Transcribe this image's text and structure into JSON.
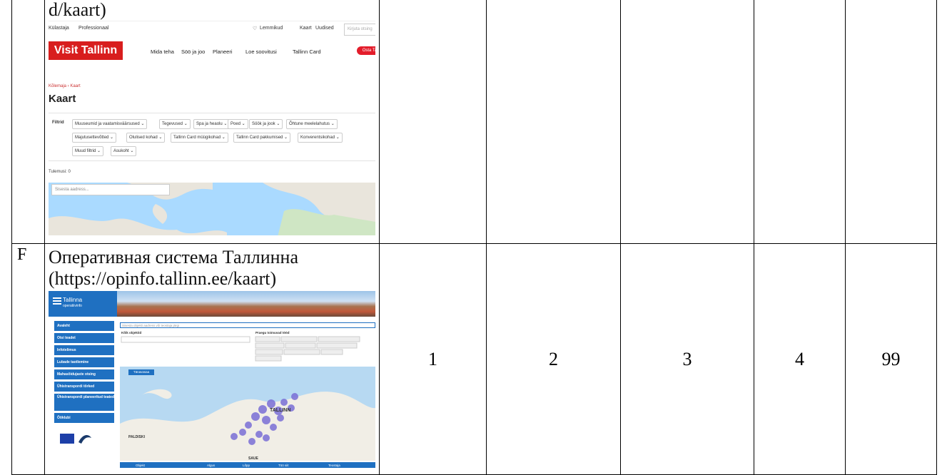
{
  "rows": [
    {
      "letter": "",
      "caption": "d/kaart)",
      "nums": [
        "",
        "",
        "",
        "",
        ""
      ],
      "visit_tallinn": {
        "top_left": [
          "Külastaja",
          "Professionaal"
        ],
        "top_right": [
          "Lemmikud",
          "Kaart",
          "Uudised"
        ],
        "search_placeholder": "Kirjuta otsing",
        "brand": "Visit Tallinn",
        "nav": [
          "Mida teha",
          "Söö ja joo",
          "Planeeri",
          "Loe soovitusi",
          "Tallinn Card"
        ],
        "buy": "Osta Talli",
        "breadcrumb": "Kõlemaja › Kaart",
        "title": "Kaart",
        "filter_label": "Filtrid",
        "filters": [
          "Muuseumid ja vaatamisväärsused ⌄",
          "Tegevused ⌄",
          "Spa ja heaolu ⌄",
          "Poed ⌄",
          "Söök ja jook ⌄",
          "Õhtune meelelahutus ⌄",
          "Majutusettevõtted ⌄",
          "Olulised kohad ⌄",
          "Tallinn Card müügikohad ⌄",
          "Tallinn Card pakkumised ⌄",
          "Konverentsikohad ⌄",
          "Muud filtrid ⌄",
          "Asukoht ⌄"
        ],
        "results": "Tulemusi: 0",
        "address_placeholder": "Sisesta aadress..."
      }
    },
    {
      "letter": "F",
      "caption_line1": "Оперативная система Таллинна",
      "caption_line2": "(https://opinfo.tallinn.ee/kaart)",
      "nums": [
        "1",
        "2",
        "3",
        "4",
        "99"
      ],
      "opinfo": {
        "logo_line1": "Tallinna",
        "logo_line2": "operatiivinfo",
        "menu": [
          "Avaleht",
          "Otsi teadet",
          "Infotelimus",
          "Lubade taotlemine",
          "Mahasõidujaste otsing",
          "Ühistranspordi tõrked",
          "Ühistranspordi planeeritud teated",
          "Ööklubi"
        ],
        "search_placeholder": "Sisesta objekti aadress või teostaja järgi",
        "filter_head_left": "Kõik objektid",
        "filter_head_right": "Praegu toimuvad tööd",
        "map_tag": "Tänavasaa",
        "map_labels": [
          "TALLINN",
          "PALDISKI",
          "SAUE"
        ],
        "table_headers": [
          "Objekt",
          "Algus",
          "Lõpp",
          "Töö siit",
          "Teostaja"
        ]
      }
    }
  ]
}
